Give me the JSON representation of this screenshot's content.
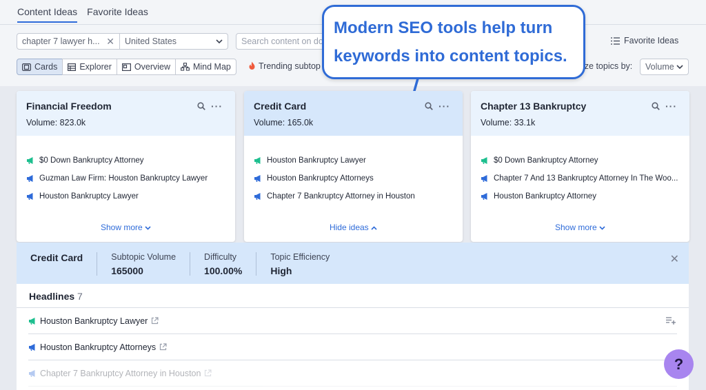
{
  "tabs": [
    {
      "label": "Content Ideas"
    },
    {
      "label": "Favorite Ideas"
    }
  ],
  "filters": {
    "keyword": "chapter 7 lawyer h...",
    "country": "United States",
    "search_placeholder": "Search content on do",
    "favorite_ideas": "Favorite Ideas"
  },
  "views": [
    {
      "label": "Cards"
    },
    {
      "label": "Explorer"
    },
    {
      "label": "Overview"
    },
    {
      "label": "Mind Map"
    }
  ],
  "trending": "Trending subtop",
  "organize": {
    "label": "ize topics by:",
    "value": "Volume"
  },
  "callout": {
    "line1": "Modern SEO tools help turn",
    "line2": "keywords into content topics."
  },
  "cards": [
    {
      "title": "Financial Freedom",
      "volume": "Volume: 823.0k",
      "ideas": [
        {
          "text": "$0 Down Bankruptcy Attorney",
          "color": "#1ebf8f"
        },
        {
          "text": "Guzman Law Firm: Houston Bankruptcy Lawyer",
          "color": "#2e6bd9"
        },
        {
          "text": "Houston Bankruptcy Lawyer",
          "color": "#2e6bd9"
        }
      ],
      "more": "Show more"
    },
    {
      "title": "Credit Card",
      "volume": "Volume: 165.0k",
      "ideas": [
        {
          "text": "Houston Bankruptcy Lawyer",
          "color": "#1ebf8f"
        },
        {
          "text": "Houston Bankruptcy Attorneys",
          "color": "#2e6bd9"
        },
        {
          "text": "Chapter 7 Bankruptcy Attorney in Houston",
          "color": "#2e6bd9"
        }
      ],
      "more": "Hide ideas"
    },
    {
      "title": "Chapter 13 Bankruptcy",
      "volume": "Volume: 33.1k",
      "ideas": [
        {
          "text": "$0 Down Bankruptcy Attorney",
          "color": "#1ebf8f"
        },
        {
          "text": "Chapter 7 And 13 Bankruptcy Attorney In The Woo...",
          "color": "#2e6bd9"
        },
        {
          "text": "Houston Bankruptcy Attorney",
          "color": "#2e6bd9"
        }
      ],
      "more": "Show more"
    }
  ],
  "panel": {
    "title": "Credit Card",
    "subtopic_volume_label": "Subtopic Volume",
    "subtopic_volume": "165000",
    "difficulty_label": "Difficulty",
    "difficulty": "100.00%",
    "efficiency_label": "Topic Efficiency",
    "efficiency": "High",
    "headlines_label": "Headlines",
    "headlines_count": "7",
    "headlines": [
      {
        "text": "Houston Bankruptcy Lawyer",
        "color": "#1ebf8f"
      },
      {
        "text": "Houston Bankruptcy Attorneys",
        "color": "#2e6bd9"
      },
      {
        "text": "Chapter 7 Bankruptcy Attorney in Houston",
        "color": "#2e6bd9"
      }
    ]
  },
  "help": "?"
}
